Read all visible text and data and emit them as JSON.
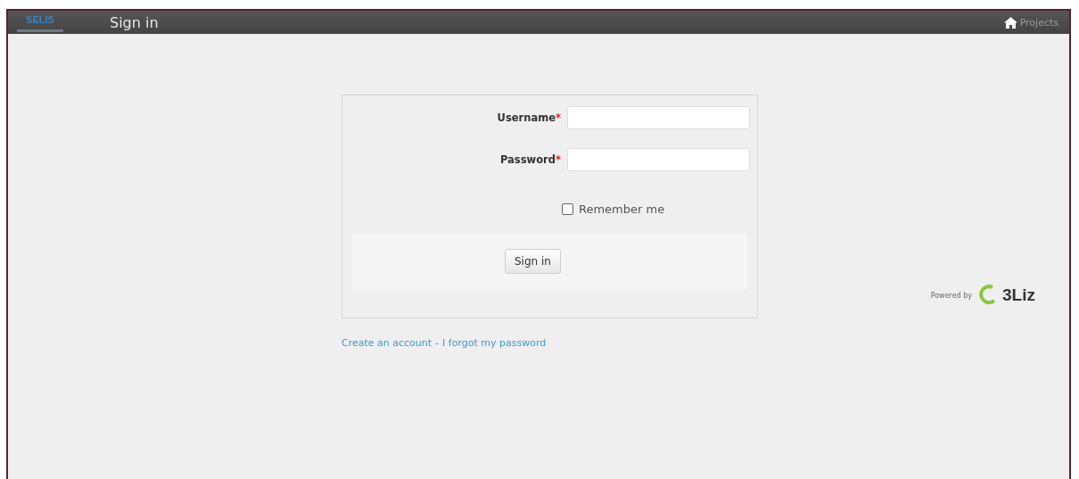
{
  "header": {
    "logo": "SELIS",
    "title": "Sign in",
    "nav_link": "Projects"
  },
  "form": {
    "fields": [
      {
        "label": "Username",
        "required_mark": "*"
      },
      {
        "label": "Password",
        "required_mark": "*"
      }
    ],
    "remember": {
      "label": "Remember me",
      "checked": false
    },
    "submit": "Sign in"
  },
  "links": [
    {
      "label": "Create an account"
    },
    {
      "label": "I forgot my password"
    }
  ],
  "link_separator": "-",
  "footer": {
    "powered_by": "Powered by",
    "brand": "3Liz"
  }
}
